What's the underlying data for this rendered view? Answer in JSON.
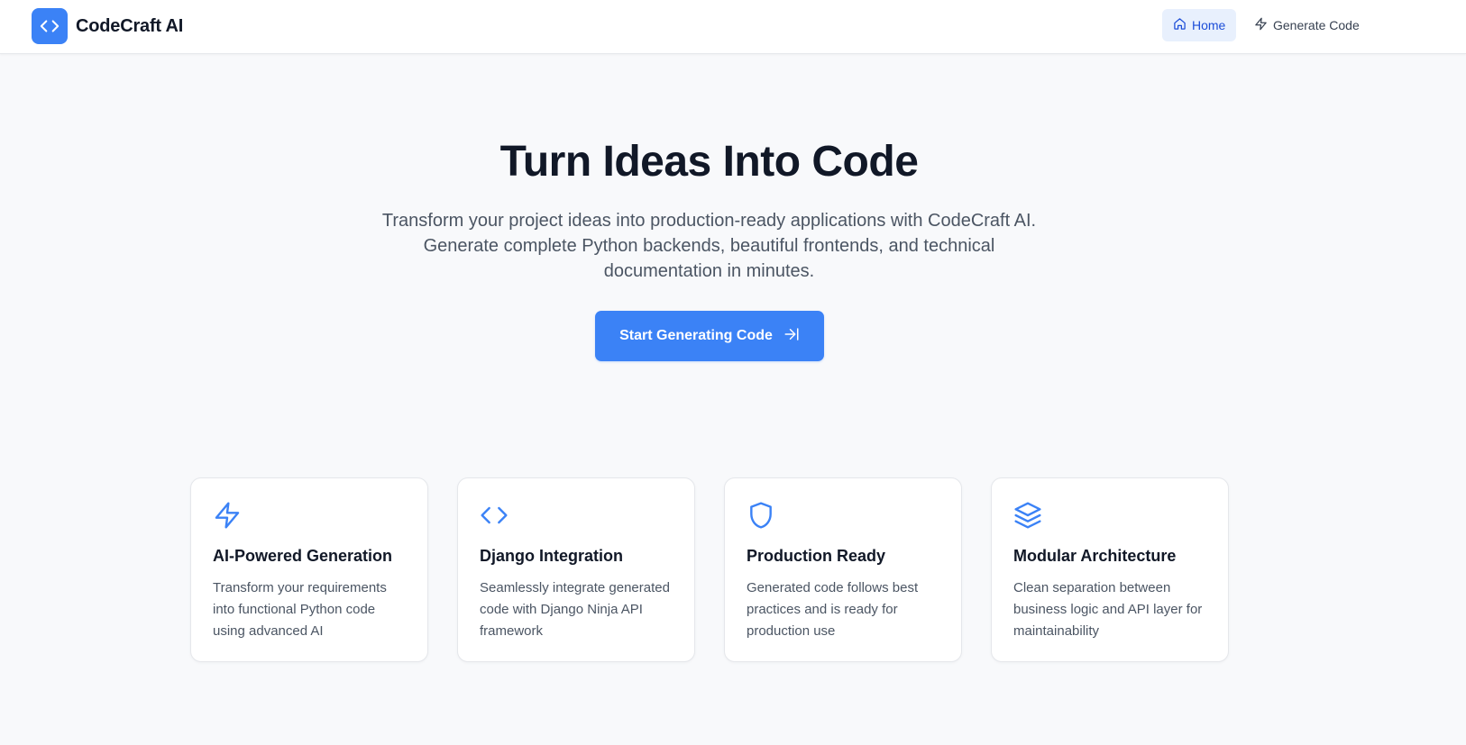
{
  "brand": {
    "name": "CodeCraft AI",
    "logo_icon": "code-brackets-icon"
  },
  "nav": {
    "home_label": "Home",
    "home_icon": "home-icon",
    "generate_label": "Generate Code",
    "generate_icon": "lightning-icon",
    "active": "Home"
  },
  "hero": {
    "title": "Turn Ideas Into Code",
    "subtitle": "Transform your project ideas into production-ready applications with CodeCraft AI. Generate complete Python backends, beautiful frontends, and technical documentation in minutes.",
    "cta_label": "Start Generating Code",
    "cta_icon": "arrow-right-to-line-icon"
  },
  "features": [
    {
      "icon": "lightning-icon",
      "title": "AI-Powered Generation",
      "description": "Transform your requirements into functional Python code using advanced AI"
    },
    {
      "icon": "code-brackets-icon",
      "title": "Django Integration",
      "description": "Seamlessly integrate generated code with Django Ninja API framework"
    },
    {
      "icon": "shield-icon",
      "title": "Production Ready",
      "description": "Generated code follows best practices and is ready for production use"
    },
    {
      "icon": "layers-icon",
      "title": "Modular Architecture",
      "description": "Clean separation between business logic and API layer for maintainability"
    }
  ],
  "colors": {
    "accent": "#3b82f6",
    "accent_light": "#e8f0fd",
    "nav_active_text": "#1d4ed8",
    "background": "#f8f9fb",
    "heading": "#111827",
    "body_text": "#4b5563"
  }
}
